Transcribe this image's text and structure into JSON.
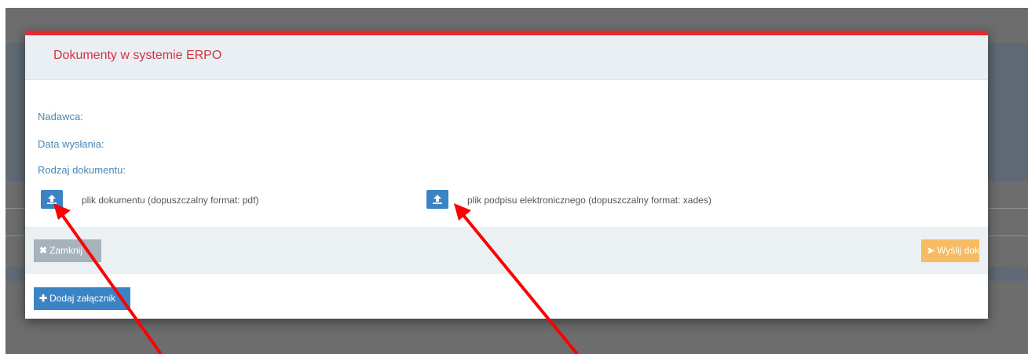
{
  "dialog": {
    "title": "Dokumenty w systemie ERPO",
    "fields": [
      {
        "label": "Nadawca:"
      },
      {
        "label": "Data wysłania:"
      },
      {
        "label": "Rodzaj dokumentu:"
      }
    ],
    "uploads": {
      "document": {
        "label": "plik dokumentu (dopuszczalny format: pdf)"
      },
      "signature": {
        "label": "plik podpisu elektronicznego (dopuszczalny format: xades)"
      }
    },
    "footer": {
      "close_label": "Zamknij",
      "send_label": "Wyślij dokumenty"
    },
    "add_attachment_label": "Dodaj załącznik"
  },
  "colors": {
    "title": "#d2323d",
    "top_bar": "#e32b36",
    "label": "#4b88b5",
    "primary_button": "#3a83c4",
    "close_button": "#a7b3bb",
    "send_button": "#f6bb63",
    "annotation_arrow": "#ff0000"
  },
  "icons": {
    "upload": "upload-icon",
    "close": "times-icon",
    "send": "paper-plane-icon",
    "add": "plus-icon"
  }
}
